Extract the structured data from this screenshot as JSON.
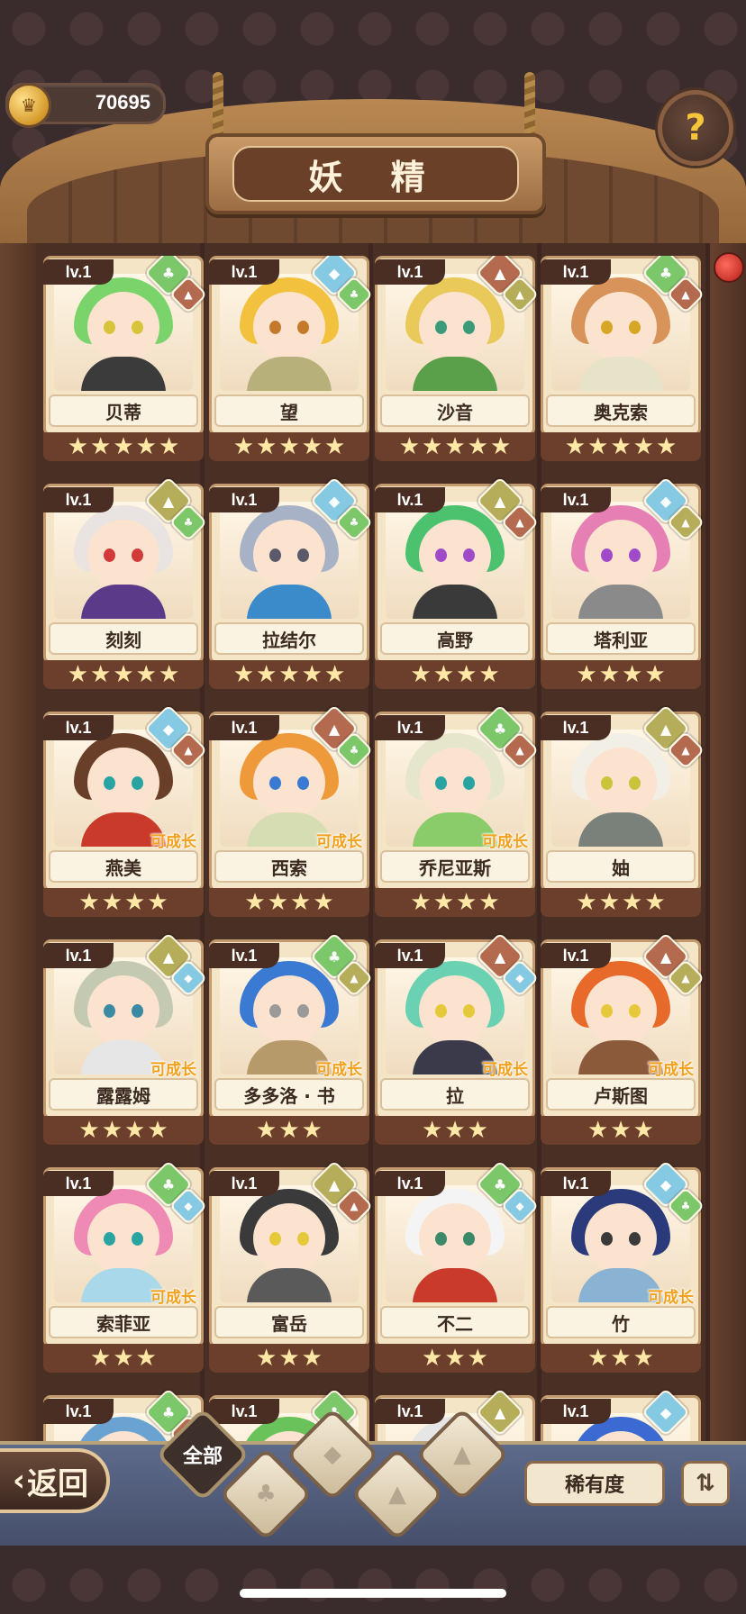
{
  "currency": {
    "value": "70695",
    "icon": "coin-icon"
  },
  "title": "妖 精",
  "help_icon": "?",
  "grid": [
    {
      "lv": "lv.1",
      "name": "贝蒂",
      "stars": 5,
      "elements": [
        "plant",
        "fire"
      ],
      "grow": "",
      "hair": "#7bd46b",
      "body": "#3b3b3b",
      "eye": "#d8c43a"
    },
    {
      "lv": "lv.1",
      "name": "望",
      "stars": 5,
      "elements": [
        "water",
        "plant"
      ],
      "grow": "",
      "hair": "#f2c23f",
      "body": "#b7b07a",
      "eye": "#c47a2a"
    },
    {
      "lv": "lv.1",
      "name": "沙音",
      "stars": 5,
      "elements": [
        "fire",
        "earth"
      ],
      "grow": "",
      "hair": "#e9c95a",
      "body": "#5aa04a",
      "eye": "#3a9a7a"
    },
    {
      "lv": "lv.1",
      "name": "奥克索",
      "stars": 5,
      "elements": [
        "plant",
        "fire"
      ],
      "grow": "",
      "hair": "#d7935a",
      "body": "#e6e3c9",
      "eye": "#d6a624"
    },
    {
      "lv": "lv.1",
      "name": "刻刻",
      "stars": 5,
      "elements": [
        "earth",
        "plant"
      ],
      "grow": "",
      "hair": "#e9e4e1",
      "body": "#5b3a8a",
      "eye": "#d23a3a"
    },
    {
      "lv": "lv.1",
      "name": "拉结尔",
      "stars": 5,
      "elements": [
        "water",
        "plant"
      ],
      "grow": "",
      "hair": "#a8b2c6",
      "body": "#3b8ac9",
      "eye": "#5a5a6a"
    },
    {
      "lv": "lv.1",
      "name": "高野",
      "stars": 4,
      "elements": [
        "earth",
        "fire"
      ],
      "grow": "",
      "hair": "#4cc26e",
      "body": "#3a3a3a",
      "eye": "#a14ac9"
    },
    {
      "lv": "lv.1",
      "name": "塔利亚",
      "stars": 4,
      "elements": [
        "water",
        "earth"
      ],
      "grow": "",
      "hair": "#e57fb4",
      "body": "#8a8a8a",
      "eye": "#a14ac9"
    },
    {
      "lv": "lv.1",
      "name": "燕美",
      "stars": 4,
      "elements": [
        "water",
        "fire"
      ],
      "grow": "可成长",
      "hair": "#6a3f2a",
      "body": "#c93a2a",
      "eye": "#2aa3a3"
    },
    {
      "lv": "lv.1",
      "name": "西索",
      "stars": 4,
      "elements": [
        "fire",
        "plant"
      ],
      "grow": "可成长",
      "hair": "#ef9a3a",
      "body": "#d7ddb2",
      "eye": "#3a7ad2"
    },
    {
      "lv": "lv.1",
      "name": "乔尼亚斯",
      "stars": 4,
      "elements": [
        "plant",
        "fire"
      ],
      "grow": "可成长",
      "hair": "#e6e6cc",
      "body": "#8acb6a",
      "eye": "#2aa3a3"
    },
    {
      "lv": "lv.1",
      "name": "妯",
      "stars": 4,
      "elements": [
        "earth",
        "fire"
      ],
      "grow": "",
      "hair": "#f2efe6",
      "body": "#7a807a",
      "eye": "#c9c43a"
    },
    {
      "lv": "lv.1",
      "name": "露露姆",
      "stars": 4,
      "elements": [
        "earth",
        "water"
      ],
      "grow": "可成长",
      "hair": "#c4c9b2",
      "body": "#e6e6e6",
      "eye": "#3a8aa3"
    },
    {
      "lv": "lv.1",
      "name": "多多洛 · 书",
      "stars": 3,
      "elements": [
        "plant",
        "earth"
      ],
      "grow": "可成长",
      "hair": "#3a7ad2",
      "body": "#b79a6a",
      "eye": "#9a9a9a"
    },
    {
      "lv": "lv.1",
      "name": "拉",
      "stars": 3,
      "elements": [
        "fire",
        "water"
      ],
      "grow": "可成长",
      "hair": "#6ad2b2",
      "body": "#3a3a4a",
      "eye": "#e6c93a"
    },
    {
      "lv": "lv.1",
      "name": "卢斯图",
      "stars": 3,
      "elements": [
        "fire",
        "earth"
      ],
      "grow": "可成长",
      "hair": "#e86a2a",
      "body": "#8a5a3a",
      "eye": "#e6c93a"
    },
    {
      "lv": "lv.1",
      "name": "索菲亚",
      "stars": 3,
      "elements": [
        "plant",
        "water"
      ],
      "grow": "可成长",
      "hair": "#ef8ab4",
      "body": "#a8d8ea",
      "eye": "#2aa3a3"
    },
    {
      "lv": "lv.1",
      "name": "富岳",
      "stars": 3,
      "elements": [
        "earth",
        "fire"
      ],
      "grow": "",
      "hair": "#3a3a3a",
      "body": "#5a5a5a",
      "eye": "#e6c93a"
    },
    {
      "lv": "lv.1",
      "name": "不二",
      "stars": 3,
      "elements": [
        "plant",
        "water"
      ],
      "grow": "",
      "hair": "#f4f4f4",
      "body": "#c93a2a",
      "eye": "#3a8a6a"
    },
    {
      "lv": "lv.1",
      "name": "竹",
      "stars": 3,
      "elements": [
        "water",
        "plant"
      ],
      "grow": "可成长",
      "hair": "#2a3a7a",
      "body": "#8ab2d2",
      "eye": "#3a3a3a"
    },
    {
      "lv": "lv.1",
      "name": "",
      "stars": 0,
      "elements": [
        "plant",
        "fire"
      ],
      "grow": "",
      "hair": "#6aa3d2",
      "body": "#6aa3d2",
      "eye": "#3a3a3a"
    },
    {
      "lv": "lv.1",
      "name": "",
      "stars": 0,
      "elements": [
        "plant"
      ],
      "grow": "",
      "hair": "#6ac25a",
      "body": "#6ac25a",
      "eye": "#3a3a3a"
    },
    {
      "lv": "lv.1",
      "name": "",
      "stars": 0,
      "elements": [
        "earth"
      ],
      "grow": "",
      "hair": "#e6e6e6",
      "body": "#e6e6e6",
      "eye": "#3a3a3a"
    },
    {
      "lv": "lv.1",
      "name": "",
      "stars": 0,
      "elements": [
        "water"
      ],
      "grow": "",
      "hair": "#3a6ad2",
      "body": "#3a6ad2",
      "eye": "#3a3a3a"
    }
  ],
  "bottom": {
    "back": "返回",
    "filters": [
      {
        "name": "all",
        "label": "全部",
        "active": true
      },
      {
        "name": "plant",
        "label": "♣",
        "active": false
      },
      {
        "name": "water",
        "label": "◆",
        "active": false
      },
      {
        "name": "earth",
        "label": "▲",
        "active": false
      },
      {
        "name": "fire",
        "label": "▲",
        "active": false
      }
    ],
    "rarity": "稀有度",
    "sort": "⇅"
  },
  "colors": {
    "plant": "#7bc76a",
    "water": "#86c9e2",
    "fire": "#b46a4f",
    "earth": "#b5ad5a"
  }
}
